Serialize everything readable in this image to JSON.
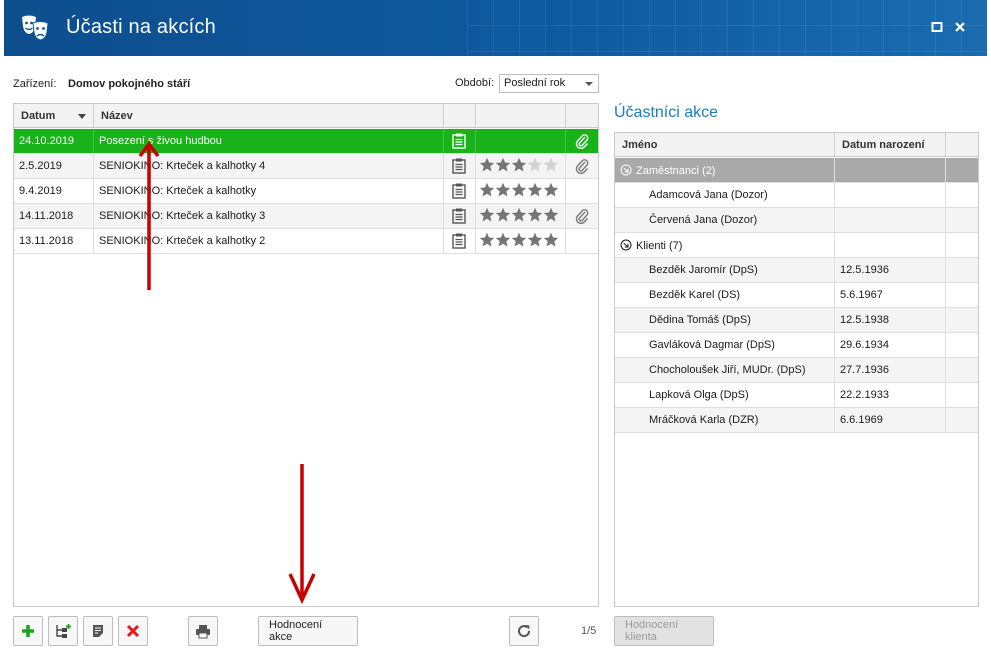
{
  "window": {
    "title": "Účasti na akcích"
  },
  "filters": {
    "facility_label": "Zařízení:",
    "facility_value": "Domov pokojného stáří",
    "period_label": "Období:",
    "period_value": "Poslední rok"
  },
  "events_table": {
    "columns": [
      "Datum",
      "Název"
    ],
    "rows": [
      {
        "date": "24.10.2019",
        "name": "Posezení s živou hudbou",
        "rating": 0,
        "has_attachment": true
      },
      {
        "date": "2.5.2019",
        "name": "SENIOKINO: Krteček a kalhotky 4",
        "rating": 3,
        "has_attachment": true
      },
      {
        "date": "9.4.2019",
        "name": "SENIOKINO: Krteček a kalhotky",
        "rating": 5,
        "has_attachment": false
      },
      {
        "date": "14.11.2018",
        "name": "SENIOKINO: Krteček a kalhotky 3",
        "rating": 5,
        "has_attachment": true
      },
      {
        "date": "13.11.2018",
        "name": "SENIOKINO: Krteček a kalhotky 2",
        "rating": 5,
        "has_attachment": false
      }
    ]
  },
  "participants": {
    "title": "Účastníci akce",
    "columns": [
      "Jméno",
      "Datum narození"
    ],
    "groups": [
      {
        "label": "Zaměstnanci (2)",
        "members": [
          {
            "name": "Adamcová Jana (Dozor)",
            "birth": ""
          },
          {
            "name": "Červená Jana (Dozor)",
            "birth": ""
          }
        ]
      },
      {
        "label": "Klienti (7)",
        "members": [
          {
            "name": "Bezděk Jaromír (DpS)",
            "birth": "12.5.1936"
          },
          {
            "name": "Bezděk Karel (DS)",
            "birth": "5.6.1967"
          },
          {
            "name": "Dědina Tomáš (DpS)",
            "birth": "12.5.1938"
          },
          {
            "name": "Gavláková Dagmar (DpS)",
            "birth": "29.6.1934"
          },
          {
            "name": "Chocholoušek Jiří, MUDr. (DpS)",
            "birth": "27.7.1936"
          },
          {
            "name": "Lapková Olga (DpS)",
            "birth": "22.2.1933"
          },
          {
            "name": "Mráčková Karla (DZR)",
            "birth": "6.6.1969"
          }
        ]
      }
    ]
  },
  "toolbar": {
    "rate_event_label": "Hodnocení akce",
    "pager": "1/5",
    "rate_client_label": "Hodnocení klienta"
  },
  "icons": {
    "app": "theater-masks-icon",
    "add": "plus-icon",
    "add_sub": "add-sub-item-icon",
    "edit": "note-edit-icon",
    "delete": "delete-x-icon",
    "print": "printer-icon",
    "refresh": "refresh-icon",
    "note": "clipboard-icon",
    "attachment": "paperclip-icon",
    "star": "star-icon"
  },
  "colors": {
    "titlebar": "#0f5a9f",
    "selected_row": "#19b21b",
    "accent_title": "#1a7cc2",
    "star_on": "#757575",
    "star_off": "#d2d2d2",
    "delete": "#e21b1b",
    "add": "#20a020",
    "annotation_arrow": "#c80000"
  }
}
